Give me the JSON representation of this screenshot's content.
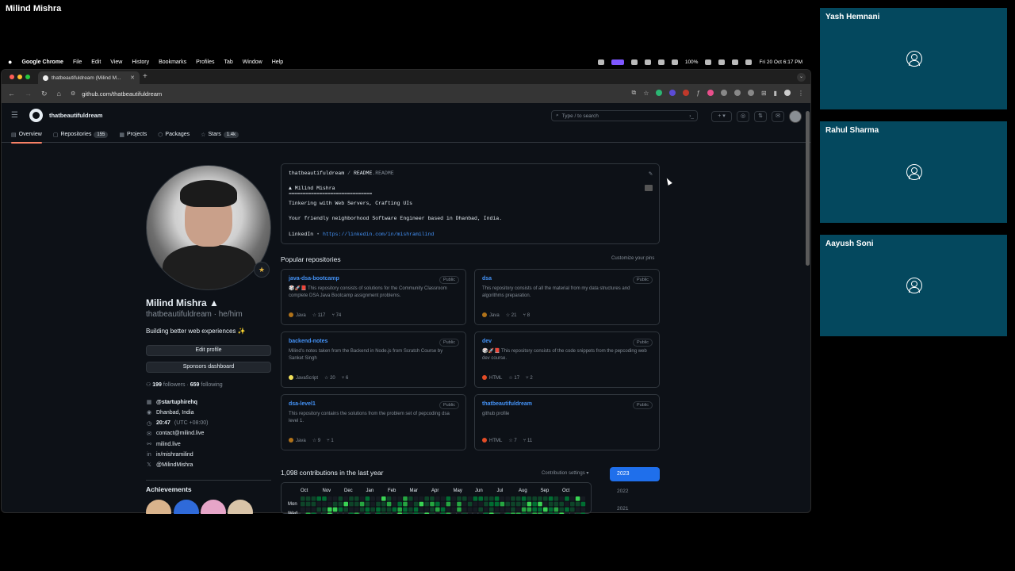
{
  "meeting": {
    "speaker_name": "Milind Mishra",
    "participants": [
      "Yash Hemnani",
      "Rahul Sharma",
      "Aayush Soni"
    ]
  },
  "menubar": {
    "app": "Google Chrome",
    "items": [
      "File",
      "Edit",
      "View",
      "History",
      "Bookmarks",
      "Profiles",
      "Tab",
      "Window",
      "Help"
    ],
    "battery": "100%",
    "clock": "Fri 20 Oct  6:17 PM"
  },
  "browser": {
    "tab_title": "thatbeautifuldream (Milind M...",
    "url": "github.com/thatbeautifuldream"
  },
  "github": {
    "username": "thatbeautifuldream",
    "search_placeholder": "Type / to search",
    "nav": [
      {
        "label": "Overview",
        "count": ""
      },
      {
        "label": "Repositories",
        "count": "155"
      },
      {
        "label": "Projects",
        "count": ""
      },
      {
        "label": "Packages",
        "count": ""
      },
      {
        "label": "Stars",
        "count": "1.4k"
      }
    ],
    "profile": {
      "full_name": "Milind Mishra ▲",
      "handle": "thatbeautifuldream · he/him",
      "bio": "Building better web experiences ✨",
      "edit_button": "Edit profile",
      "sponsors_button": "Sponsors dashboard",
      "followers": "199",
      "followers_label": "followers",
      "following": "659",
      "following_label": "following",
      "org": "@startuphirehq",
      "location": "Dhanbad, India",
      "local_time": "20:47",
      "tz": "(UTC +08:00)",
      "email": "contact@milind.live",
      "website": "milind.live",
      "linkedin": "in/mishramilind",
      "twitter": "@MilindMishra",
      "achievements_label": "Achievements"
    },
    "readme": {
      "path_user": "thatbeautifuldream",
      "path_sep": "/",
      "path_file": "README",
      "path_ext": ".README",
      "heading": "▲ Milind Mishra",
      "underline": "==============================",
      "line1": "Tinkering with Web Servers, Crafting UIs",
      "line2": "Your friendly neighborhood Software Engineer based in Dhanbad, India.",
      "linkedin_label": "LinkedIn",
      "linkedin_sep": "•",
      "linkedin_url": "https://linkedin.com/in/mishramilind"
    },
    "popular_label": "Popular repositories",
    "customize_label": "Customize your pins",
    "repos": [
      {
        "name": "java-dsa-bootcamp",
        "badge": "Public",
        "desc": "🎲🚀📕 This repository consists of solutions for the Community Classroom complete DSA Java Bootcamp assignment problems.",
        "lang": "Java",
        "lang_color": "#b07219",
        "stars": "117",
        "forks": "74"
      },
      {
        "name": "dsa",
        "badge": "Public",
        "desc": "This repository consists of all the material from my data structures and algorithms preparation.",
        "lang": "Java",
        "lang_color": "#b07219",
        "stars": "21",
        "forks": "8"
      },
      {
        "name": "backend-notes",
        "badge": "Public",
        "desc": "Milind's notes taken from the Backend in Node.js from Scratch Course by Sanket Singh",
        "lang": "JavaScript",
        "lang_color": "#f1e05a",
        "stars": "20",
        "forks": "6"
      },
      {
        "name": "dev",
        "badge": "Public",
        "desc": "🎲🚀📕 This repository consists of the code snippets from the pepcoding web dev course.",
        "lang": "HTML",
        "lang_color": "#e34c26",
        "stars": "17",
        "forks": "2"
      },
      {
        "name": "dsa-level1",
        "badge": "Public",
        "desc": "This repository contains the solutions from the problem set of pepcoding dsa level 1.",
        "lang": "Java",
        "lang_color": "#b07219",
        "stars": "9",
        "forks": "1"
      },
      {
        "name": "thatbeautifuldream",
        "badge": "Public",
        "desc": "github profile",
        "lang": "HTML",
        "lang_color": "#e34c26",
        "stars": "7",
        "forks": "11"
      }
    ],
    "contrib": {
      "title": "1,098 contributions in the last year",
      "settings": "Contribution settings ▾",
      "months": [
        "Oct",
        "Nov",
        "Dec",
        "Jan",
        "Feb",
        "Mar",
        "Apr",
        "May",
        "Jun",
        "Jul",
        "Aug",
        "Sep",
        "Oct"
      ],
      "days": [
        "Mon",
        "Wed"
      ],
      "years": [
        "2023",
        "2022",
        "2021"
      ]
    }
  }
}
